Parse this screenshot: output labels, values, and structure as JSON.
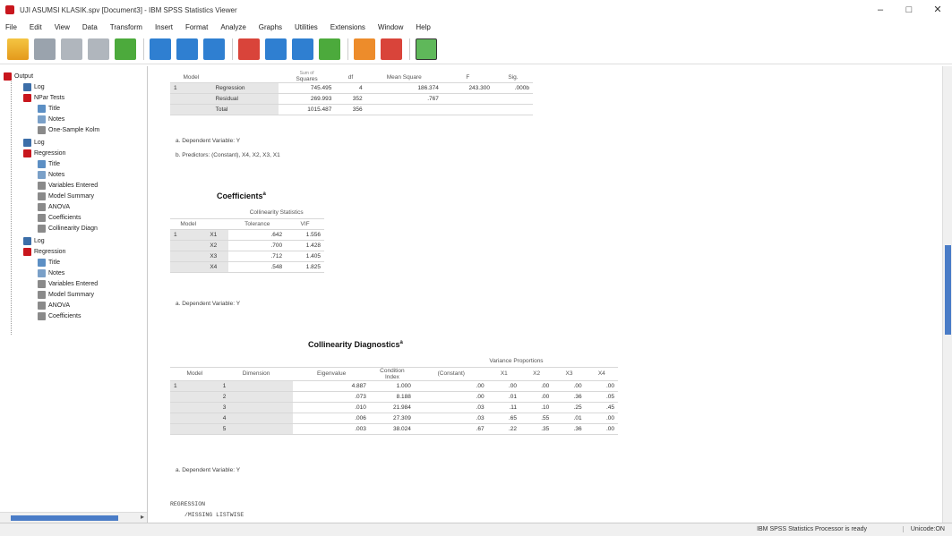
{
  "window": {
    "title": "UJI ASUMSI KLASIK.spv [Document3] - IBM SPSS Statistics Viewer",
    "controls": [
      "–",
      "□",
      "✕"
    ]
  },
  "menu": [
    "File",
    "Edit",
    "View",
    "Data",
    "Transform",
    "Insert",
    "Format",
    "Analyze",
    "Graphs",
    "Utilities",
    "Extensions",
    "Window",
    "Help"
  ],
  "outline": {
    "items": [
      {
        "label": "Output",
        "icon": "output-book-icon"
      },
      {
        "label": "Log",
        "icon": "log-icon"
      },
      {
        "label": "NPar Tests",
        "icon": "output-book-icon"
      },
      {
        "label": "Title",
        "icon": "title-icon"
      },
      {
        "label": "Notes",
        "icon": "notes-icon"
      },
      {
        "label": "One-Sample Kolm",
        "icon": "table-icon"
      },
      {
        "label": "Log",
        "icon": "log-icon"
      },
      {
        "label": "Regression",
        "icon": "output-book-icon"
      },
      {
        "label": "Title",
        "icon": "title-icon"
      },
      {
        "label": "Notes",
        "icon": "notes-icon"
      },
      {
        "label": "Variables Entered",
        "icon": "table-icon"
      },
      {
        "label": "Model Summary",
        "icon": "table-icon"
      },
      {
        "label": "ANOVA",
        "icon": "table-icon"
      },
      {
        "label": "Coefficients",
        "icon": "table-icon"
      },
      {
        "label": "Collinearity Diagn",
        "icon": "table-icon"
      },
      {
        "label": "Log",
        "icon": "log-icon"
      },
      {
        "label": "Regression",
        "icon": "output-book-icon"
      },
      {
        "label": "Title",
        "icon": "title-icon"
      },
      {
        "label": "Notes",
        "icon": "notes-icon"
      },
      {
        "label": "Variables Entered",
        "icon": "table-icon"
      },
      {
        "label": "Model Summary",
        "icon": "table-icon"
      },
      {
        "label": "ANOVA",
        "icon": "table-icon"
      },
      {
        "label": "Coefficients",
        "icon": "table-icon"
      }
    ]
  },
  "anova": {
    "headers": [
      "Model",
      "",
      "Squares",
      "df",
      "Mean Square",
      "F",
      "Sig."
    ],
    "header_top": "Sum of",
    "rows": [
      [
        "1",
        "Regression",
        "745.495",
        "4",
        "186.374",
        "243.300",
        ".000b"
      ],
      [
        "",
        "Residual",
        "269.993",
        "352",
        ".767",
        "",
        ""
      ],
      [
        "",
        "Total",
        "1015.487",
        "356",
        "",
        "",
        ""
      ]
    ],
    "footnotes": [
      "a. Dependent Variable: Y",
      "b. Predictors: (Constant), X4, X2, X3, X1"
    ]
  },
  "coefficients": {
    "title": "Coefficients",
    "sup": "a",
    "group_header": "Collinearity Statistics",
    "headers": [
      "Model",
      "",
      "Tolerance",
      "VIF"
    ],
    "rows": [
      [
        "1",
        "X1",
        ".642",
        "1.556"
      ],
      [
        "",
        "X2",
        ".700",
        "1.428"
      ],
      [
        "",
        "X3",
        ".712",
        "1.405"
      ],
      [
        "",
        "X4",
        ".548",
        "1.825"
      ]
    ],
    "footnote": "a. Dependent Variable: Y"
  },
  "diagnostics": {
    "title": "Collinearity Diagnostics",
    "sup": "a",
    "group_header": "Variance Proportions",
    "cond_header": "Condition Index",
    "headers": [
      "Model",
      "Dimension",
      "Eigenvalue",
      "Condition Index",
      "(Constant)",
      "X1",
      "X2",
      "X3",
      "X4"
    ],
    "rows": [
      [
        "1",
        "1",
        "4.887",
        "1.000",
        ".00",
        ".00",
        ".00",
        ".00",
        ".00"
      ],
      [
        "",
        "2",
        ".073",
        "8.188",
        ".00",
        ".01",
        ".00",
        ".36",
        ".05"
      ],
      [
        "",
        "3",
        ".010",
        "21.984",
        ".03",
        ".11",
        ".10",
        ".25",
        ".45"
      ],
      [
        "",
        "4",
        ".006",
        "27.309",
        ".03",
        ".65",
        ".55",
        ".01",
        ".00"
      ],
      [
        "",
        "5",
        ".003",
        "38.024",
        ".67",
        ".22",
        ".35",
        ".36",
        ".00"
      ]
    ],
    "footnote": "a. Dependent Variable: Y"
  },
  "syntax": {
    "line1": "REGRESSION",
    "line2": "/MISSING LISTWISE"
  },
  "status": {
    "main": "IBM SPSS Statistics Processor is ready",
    "unicode": "Unicode:ON"
  }
}
